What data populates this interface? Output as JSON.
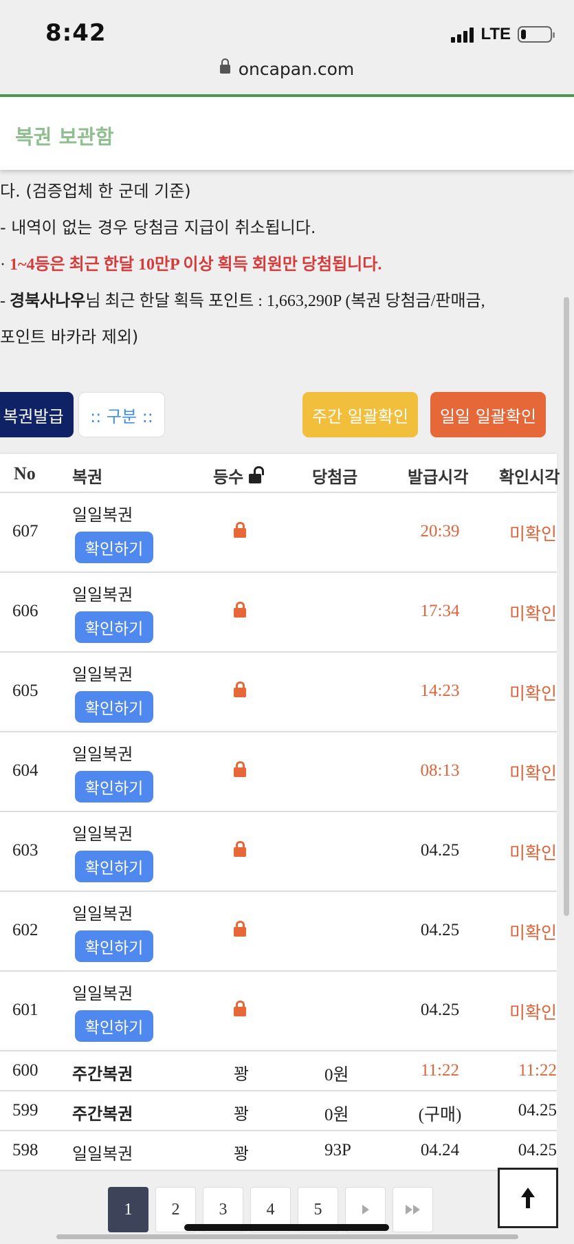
{
  "status_bar": {
    "time": "8:42",
    "network": "LTE"
  },
  "browser": {
    "url": "oncapan.com"
  },
  "header": {
    "title": "복권 보관함"
  },
  "notice": {
    "line1": "다. (검증업체 한 군데 기준)",
    "line2": "  - 내역이 없는 경우 당첨금 지급이 취소됩니다.",
    "line3_bullet": " · ",
    "line3": "1~4등은 최근 한달 10만P 이상 획득 회원만 당첨됩니다.",
    "line4_prefix": "  - ",
    "line4_user": "경북사나우",
    "line4_rest": "님 최근 한달 획득 포인트 : 1,663,290P (복권 당첨금/판매금,",
    "line5": "포인트 바카라 제외)"
  },
  "buttons": {
    "issue": "복권발급",
    "category": ":: 구분 ::",
    "weekly_check": "주간 일괄확인",
    "daily_check": "일일 일괄확인"
  },
  "table": {
    "headers": {
      "no": "No",
      "ticket": "복권",
      "rank": "등수",
      "prize": "당첨금",
      "issued": "발급시각",
      "checked": "확인시각"
    },
    "check_button_label": "확인하기",
    "rows": [
      {
        "no": "607",
        "ticket": "일일복권",
        "rank": "",
        "prize": "",
        "issued": "20:39",
        "checked": "미확인"
      },
      {
        "no": "606",
        "ticket": "일일복권",
        "rank": "",
        "prize": "",
        "issued": "17:34",
        "checked": "미확인"
      },
      {
        "no": "605",
        "ticket": "일일복권",
        "rank": "",
        "prize": "",
        "issued": "14:23",
        "checked": "미확인"
      },
      {
        "no": "604",
        "ticket": "일일복권",
        "rank": "",
        "prize": "",
        "issued": "08:13",
        "checked": "미확인"
      },
      {
        "no": "603",
        "ticket": "일일복권",
        "rank": "",
        "prize": "",
        "issued": "04.25",
        "checked": "미확인"
      },
      {
        "no": "602",
        "ticket": "일일복권",
        "rank": "",
        "prize": "",
        "issued": "04.25",
        "checked": "미확인"
      },
      {
        "no": "601",
        "ticket": "일일복권",
        "rank": "",
        "prize": "",
        "issued": "04.25",
        "checked": "미확인"
      },
      {
        "no": "600",
        "ticket": "주간복권",
        "rank": "꽝",
        "prize": "0원",
        "issued": "11:22",
        "checked": "11:22"
      },
      {
        "no": "599",
        "ticket": "주간복권",
        "rank": "꽝",
        "prize": "0원",
        "issued": "(구매)",
        "checked": "04.25"
      },
      {
        "no": "598",
        "ticket": "일일복권",
        "rank": "꽝",
        "prize": "93P",
        "issued": "04.24",
        "checked": "04.25"
      }
    ]
  },
  "pagination": {
    "pages": [
      "1",
      "2",
      "3",
      "4",
      "5"
    ],
    "current": "1"
  },
  "colors": {
    "accent_green": "#4c9a51",
    "navy": "#0f2266",
    "yellow": "#f1bf3c",
    "orange": "#e66738",
    "blue": "#4f88ee",
    "red_text": "#d63b3b"
  }
}
